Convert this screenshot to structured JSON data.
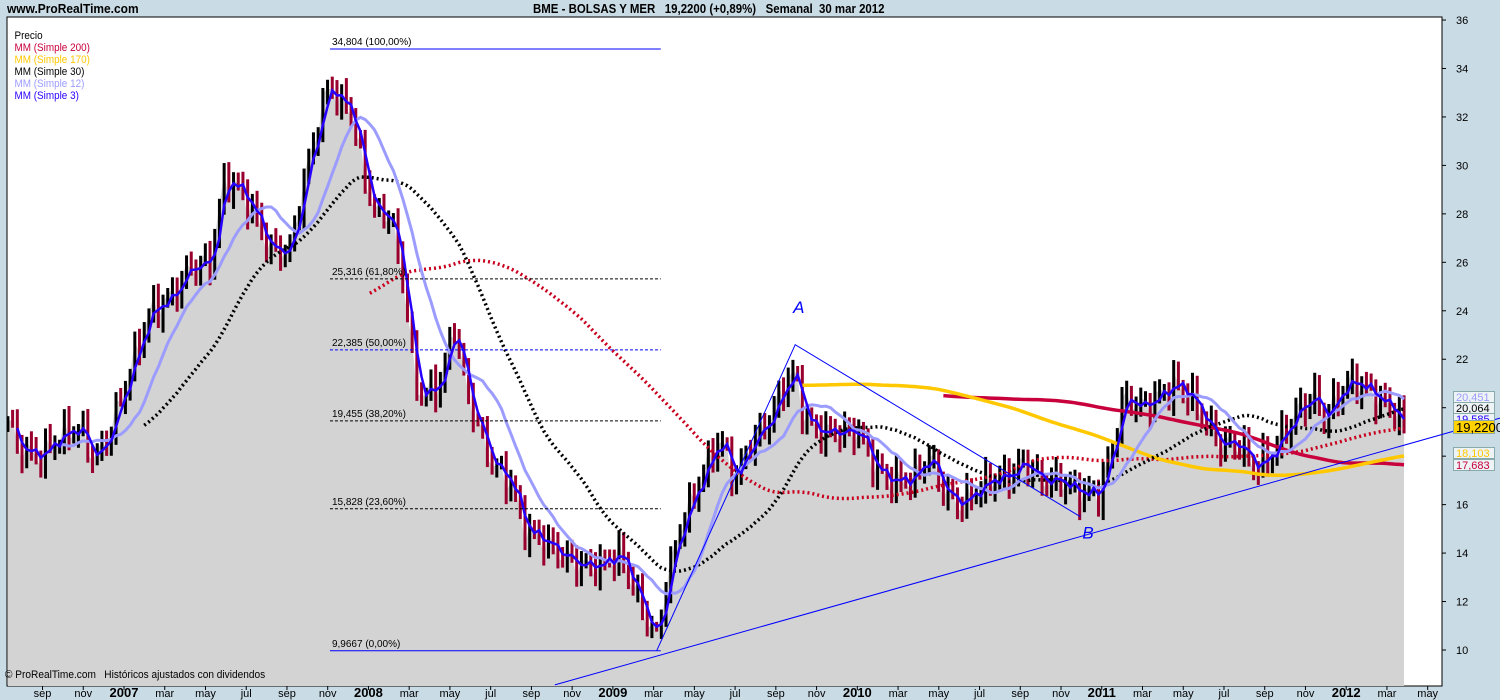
{
  "header": {
    "site": "www.ProRealTime.com",
    "title": "BME - BOLSAS Y MER   19,2200 (+0,89%)   Semanal  30 mar 2012"
  },
  "legend": [
    {
      "label": "Precio",
      "color": "#000000"
    },
    {
      "label": "MM (Simple 200)",
      "color": "#c8003c"
    },
    {
      "label": "MM (Simple 170)",
      "color": "#ffc800"
    },
    {
      "label": "MM (Simple 30)",
      "color": "#000000"
    },
    {
      "label": "MM (Simple 12)",
      "color": "#9c9cff"
    },
    {
      "label": "MM (Simple 3)",
      "color": "#2800ff"
    }
  ],
  "footer": {
    "copyright": "© ProRealTime.com   Históricos ajustados con dividendos"
  },
  "right_labels": [
    {
      "text": "20,451",
      "color": "#9c9cff",
      "bg": "#eef3f6",
      "price": 20.451
    },
    {
      "text": "20,064",
      "color": "#000000",
      "bg": "#eef3f6",
      "price": 20.064
    },
    {
      "text": "19,585",
      "color": "#2800ff",
      "bg": "#eef3f6",
      "price": 19.585
    },
    {
      "text": "19,2200",
      "color": "#000000",
      "bg": "#ffd200",
      "price": 19.22
    },
    {
      "text": "18,103",
      "color": "#ffc800",
      "bg": "#eef3f6",
      "price": 18.103
    },
    {
      "text": "17,683",
      "color": "#c8003c",
      "bg": "#eef3f6",
      "price": 17.683
    }
  ],
  "chart_data": {
    "type": "bar",
    "title": "BME - BOLSAS Y MER 19,2200 (+0,89%) Semanal 30 mar 2012",
    "x_unit": "months since Jan 2007",
    "xlim": [
      -5.69,
      64.75
    ],
    "ylim": [
      9.3,
      36.6
    ],
    "y_ticks": [
      10,
      12,
      14,
      16,
      18,
      20,
      22,
      24,
      26,
      28,
      30,
      32,
      34,
      36
    ],
    "x_ticks": [
      {
        "t": -4,
        "label": "sep"
      },
      {
        "t": -2,
        "label": "nov"
      },
      {
        "t": 0,
        "label": "2007",
        "year": true
      },
      {
        "t": 2,
        "label": "mar"
      },
      {
        "t": 4,
        "label": "may"
      },
      {
        "t": 6,
        "label": "jul"
      },
      {
        "t": 8,
        "label": "sep"
      },
      {
        "t": 10,
        "label": "nov"
      },
      {
        "t": 12,
        "label": "2008",
        "year": true
      },
      {
        "t": 14,
        "label": "mar"
      },
      {
        "t": 16,
        "label": "may"
      },
      {
        "t": 18,
        "label": "jul"
      },
      {
        "t": 20,
        "label": "sep"
      },
      {
        "t": 22,
        "label": "nov"
      },
      {
        "t": 24,
        "label": "2009",
        "year": true
      },
      {
        "t": 26,
        "label": "mar"
      },
      {
        "t": 28,
        "label": "may"
      },
      {
        "t": 30,
        "label": "jul"
      },
      {
        "t": 32,
        "label": "sep"
      },
      {
        "t": 34,
        "label": "nov"
      },
      {
        "t": 36,
        "label": "2010",
        "year": true
      },
      {
        "t": 38,
        "label": "mar"
      },
      {
        "t": 40,
        "label": "may"
      },
      {
        "t": 42,
        "label": "jul"
      },
      {
        "t": 44,
        "label": "sep"
      },
      {
        "t": 46,
        "label": "nov"
      },
      {
        "t": 48,
        "label": "2011",
        "year": true
      },
      {
        "t": 50,
        "label": "mar"
      },
      {
        "t": 52,
        "label": "may"
      },
      {
        "t": 54,
        "label": "jul"
      },
      {
        "t": 56,
        "label": "sep"
      },
      {
        "t": 58,
        "label": "nov"
      },
      {
        "t": 60,
        "label": "2012",
        "year": true
      },
      {
        "t": 62,
        "label": "mar"
      },
      {
        "t": 64,
        "label": "may"
      }
    ],
    "price_keypoints": [
      [
        -5.65,
        19.5
      ],
      [
        -5.06,
        18.3
      ],
      [
        -4.07,
        18.0
      ],
      [
        -3.09,
        18.8
      ],
      [
        -2.11,
        19.2
      ],
      [
        -1.37,
        17.8
      ],
      [
        -0.64,
        19.0
      ],
      [
        0.34,
        21.5
      ],
      [
        1.33,
        24.0
      ],
      [
        2.31,
        24.5
      ],
      [
        3.29,
        25.8
      ],
      [
        4.27,
        26.0
      ],
      [
        5.01,
        29.5
      ],
      [
        5.74,
        29.0
      ],
      [
        6.48,
        28.0
      ],
      [
        7.22,
        26.5
      ],
      [
        8.2,
        26.5
      ],
      [
        8.93,
        29.5
      ],
      [
        9.67,
        32.0
      ],
      [
        10.16,
        33.5
      ],
      [
        10.65,
        32.5
      ],
      [
        11.14,
        32.5
      ],
      [
        11.63,
        30.5
      ],
      [
        12.37,
        28.0
      ],
      [
        13.11,
        28.0
      ],
      [
        13.84,
        25.0
      ],
      [
        14.33,
        21.0
      ],
      [
        14.83,
        20.5
      ],
      [
        15.56,
        21.0
      ],
      [
        16.3,
        23.5
      ],
      [
        16.79,
        21.0
      ],
      [
        17.53,
        19.0
      ],
      [
        18.26,
        17.5
      ],
      [
        19.0,
        17.0
      ],
      [
        19.73,
        15.0
      ],
      [
        20.72,
        14.5
      ],
      [
        21.45,
        14.0
      ],
      [
        22.44,
        13.5
      ],
      [
        23.42,
        13.5
      ],
      [
        24.42,
        14.0
      ],
      [
        25.14,
        12.5
      ],
      [
        25.87,
        11.0
      ],
      [
        26.22,
        10.5
      ],
      [
        26.61,
        12.5
      ],
      [
        27.34,
        15.0
      ],
      [
        28.33,
        17.0
      ],
      [
        29.31,
        18.8
      ],
      [
        30.04,
        17.0
      ],
      [
        30.78,
        18.5
      ],
      [
        31.76,
        19.5
      ],
      [
        32.5,
        21.0
      ],
      [
        32.99,
        21.5
      ],
      [
        33.48,
        19.5
      ],
      [
        34.22,
        19.0
      ],
      [
        35.2,
        19.0
      ],
      [
        36.18,
        19.0
      ],
      [
        36.92,
        17.5
      ],
      [
        37.65,
        17.0
      ],
      [
        38.64,
        17.0
      ],
      [
        39.62,
        18.0
      ],
      [
        40.35,
        16.5
      ],
      [
        41.09,
        16.0
      ],
      [
        41.83,
        16.5
      ],
      [
        42.56,
        17.0
      ],
      [
        43.54,
        17.2
      ],
      [
        44.28,
        17.8
      ],
      [
        45.02,
        17.0
      ],
      [
        46.0,
        17.0
      ],
      [
        46.98,
        16.5
      ],
      [
        47.96,
        16.5
      ],
      [
        48.45,
        18.0
      ],
      [
        49.19,
        20.5
      ],
      [
        49.93,
        20.0
      ],
      [
        50.91,
        20.5
      ],
      [
        51.64,
        21.0
      ],
      [
        52.38,
        20.5
      ],
      [
        53.12,
        19.5
      ],
      [
        53.85,
        18.5
      ],
      [
        54.84,
        18.5
      ],
      [
        55.57,
        17.5
      ],
      [
        56.31,
        18.0
      ],
      [
        57.04,
        19.0
      ],
      [
        57.78,
        20.0
      ],
      [
        58.52,
        20.5
      ],
      [
        59.01,
        19.5
      ],
      [
        60.0,
        21.0
      ],
      [
        60.74,
        21.0
      ],
      [
        61.47,
        20.5
      ],
      [
        62.22,
        20.0
      ],
      [
        62.7,
        19.7
      ],
      [
        62.94,
        19.22
      ]
    ],
    "series": [
      {
        "name": "Precio",
        "type": "bar"
      },
      {
        "name": "MM (Simple 200)",
        "period": 200
      },
      {
        "name": "MM (Simple 170)",
        "period": 170
      },
      {
        "name": "MM (Simple 30)",
        "period": 30
      },
      {
        "name": "MM (Simple 12)",
        "period": 12
      },
      {
        "name": "MM (Simple 3)",
        "period": 3
      }
    ],
    "fib_levels": [
      {
        "value": 34.804,
        "label": "34,804 (100,00%)",
        "style": "solid"
      },
      {
        "value": 25.316,
        "label": "25,316 (61,80%)",
        "style": "dashed"
      },
      {
        "value": 22.385,
        "label": "22,385 (50,00%)",
        "style": "dashed"
      },
      {
        "value": 19.455,
        "label": "19,455 (38,20%)",
        "style": "dashed"
      },
      {
        "value": 15.828,
        "label": "15,828 (23,60%)",
        "style": "dashed"
      },
      {
        "value": 9.9667,
        "label": "9,9667 (0,00%)",
        "style": "solid"
      }
    ],
    "fib_range_t": [
      10.16,
      26.4
    ],
    "annotations": [
      {
        "text": "A",
        "t": 32.9,
        "price": 23.9
      },
      {
        "text": "B",
        "t": 47.1,
        "price": 14.6
      }
    ],
    "zigzag": [
      [
        26.2,
        9.97
      ],
      [
        33.0,
        22.6
      ],
      [
        47.0,
        15.5
      ]
    ],
    "trendline": [
      [
        21.2,
        8.56
      ],
      [
        67.6,
        19.57
      ]
    ]
  }
}
